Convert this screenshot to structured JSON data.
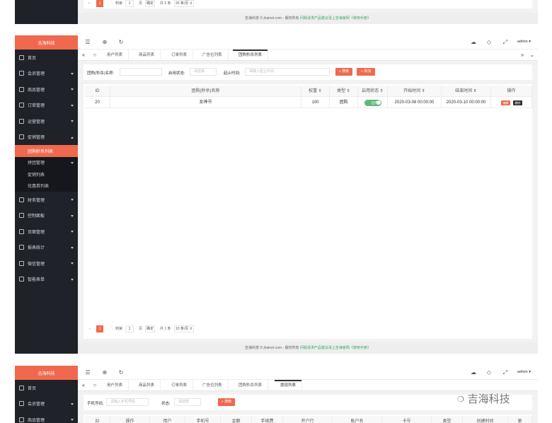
{
  "common": {
    "logo": "吉海科技",
    "user": "admin",
    "footer_text": "吉海科技 © jhainet.com - 版权所有",
    "footer_link": "问题请求产品建议请上吉海官网《使用手册》"
  },
  "top_strip": {
    "pager": {
      "prev": "‹",
      "page": "1",
      "goto_label": "到第",
      "goto_value": "1",
      "page_unit": "页",
      "confirm": "确定",
      "total": "共 5 条",
      "page_size": "20 条/页 ⇕"
    }
  },
  "frame2": {
    "menu": [
      {
        "label": "首页"
      },
      {
        "label": "会员管理"
      },
      {
        "label": "商品管理"
      },
      {
        "label": "订单管理"
      },
      {
        "label": "运营管理"
      },
      {
        "label": "促销管理"
      }
    ],
    "submenu": [
      {
        "label": "团购秒杀列表"
      },
      {
        "label": "拼团管理"
      },
      {
        "label": "促销列表"
      },
      {
        "label": "优惠券列表"
      }
    ],
    "menu2": [
      {
        "label": "财务管理"
      },
      {
        "label": "控制面板"
      },
      {
        "label": "页面管理"
      },
      {
        "label": "报表统计"
      },
      {
        "label": "微信管理"
      },
      {
        "label": "智能表单"
      }
    ],
    "tabs": [
      "用户列表",
      "商品列表",
      "订单列表",
      "广告位列表",
      "团购秒杀列表"
    ],
    "filter": {
      "name_label": "团购(秒杀)名称:",
      "status_label": "启用状态:",
      "status_placeholder": "请选择",
      "time_label": "起止时间:",
      "time_placeholder": "请输入起止时间",
      "search_btn": "搜索",
      "add_btn": "添加"
    },
    "table": {
      "headers": [
        "ID",
        "团购(秒杀)名称",
        "权重 ⇕",
        "类型 ⇕",
        "启用状态 ⇕",
        "开始时间 ⇕",
        "结束时间 ⇕",
        "操作"
      ],
      "row": {
        "id": "20",
        "name": "女神节",
        "weight": "100",
        "type": "团购",
        "status": "启用",
        "start": "2020-03-08 00:00:00",
        "end": "2020-03-10 00:00:00",
        "edit": "编辑",
        "delete": "删除"
      }
    },
    "pager": {
      "prev": "‹",
      "page": "1",
      "goto_label": "到第",
      "goto_value": "1",
      "page_unit": "页",
      "confirm": "确定",
      "total": "共 1 条",
      "page_size": "10 条/页 ⇕"
    }
  },
  "frame3": {
    "menu": [
      {
        "label": "首页"
      },
      {
        "label": "会员管理"
      },
      {
        "label": "商品管理"
      }
    ],
    "tabs": [
      "用户列表",
      "商品列表",
      "订单列表",
      "广告位列表",
      "团购秒杀列表",
      "提现列表"
    ],
    "filter": {
      "phone_label": "手机号码:",
      "phone_placeholder": "请输入手机号码",
      "status_label": "状态:",
      "status_placeholder": "请选择",
      "search_btn": "搜索"
    },
    "headers": [
      "ID",
      "操作",
      "用户",
      "手机号",
      "金额",
      "手续费",
      "开户行",
      "账户名",
      "卡号",
      "类型",
      "创建时间",
      "更"
    ]
  },
  "watermark": "吉海科技"
}
